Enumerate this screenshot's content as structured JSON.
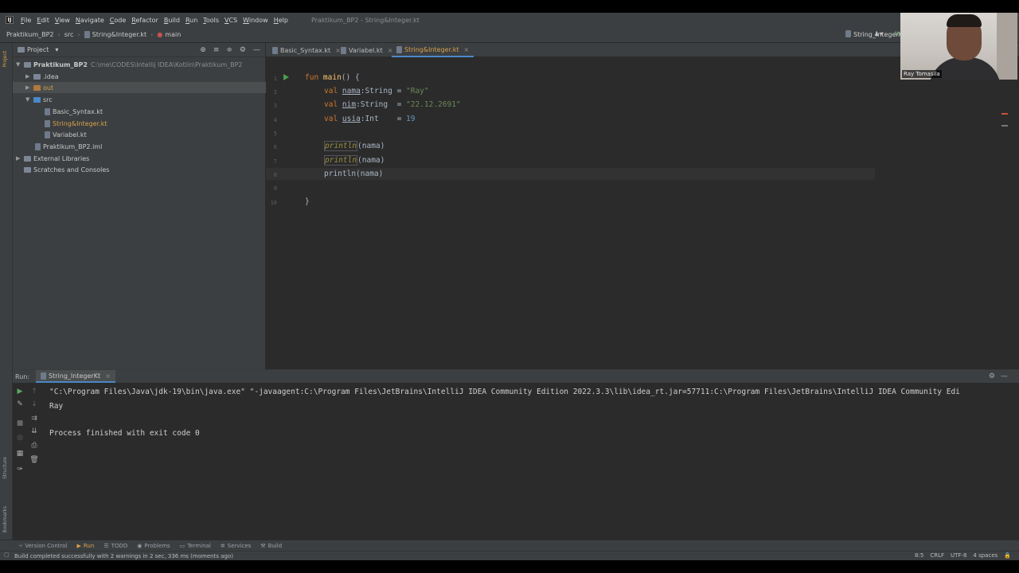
{
  "menubar": {
    "logo": "IJ",
    "items": [
      "File",
      "Edit",
      "View",
      "Navigate",
      "Code",
      "Refactor",
      "Build",
      "Run",
      "Tools",
      "VCS",
      "Window",
      "Help"
    ],
    "window_title": "Praktikum_BP2 - String&Integer.kt"
  },
  "navbar": {
    "project": "Praktikum_BP2",
    "src": "src",
    "file": "String&Integer.kt",
    "function": "main",
    "run_config": "String_IntegerKt"
  },
  "project_panel": {
    "title": "Project",
    "tree": [
      {
        "label": "Praktikum_BP2",
        "path": "C:\\me\\CODES\\Intellij IDEA\\Kotlin\\Praktikum_BP2"
      },
      {
        "label": ".idea"
      },
      {
        "label": "out"
      },
      {
        "label": "src"
      },
      {
        "label": "Basic_Syntax.kt"
      },
      {
        "label": "String&Integer.kt"
      },
      {
        "label": "Variabel.kt"
      },
      {
        "label": "Praktikum_BP2.iml"
      },
      {
        "label": "External Libraries"
      },
      {
        "label": "Scratches and Consoles"
      }
    ]
  },
  "editor_tabs": [
    "Basic_Syntax.kt",
    "Variabel.kt",
    "String&Integer.kt"
  ],
  "editor": {
    "line_numbers": [
      "1",
      "2",
      "3",
      "4",
      "5",
      "6",
      "7",
      "8",
      "9",
      "10"
    ],
    "l1_fun": "fun",
    "l1_name": "main",
    "l1_rest": "() {",
    "val": "val",
    "l2_var": "nama",
    "l2_type": ":String",
    "l2_eq": " = ",
    "l2_val": "\"Ray\"",
    "l3_var": "nim",
    "l3_type": ":String",
    "l3_eq": "  = ",
    "l3_val": "\"22.12.2691\"",
    "l4_var": "usia",
    "l4_type": ":Int",
    "l4_eq": "    = ",
    "l4_val": "19",
    "println": "println",
    "println_arg": "(nama)",
    "close_brace": "}"
  },
  "run_panel": {
    "label": "Run:",
    "tab": "String_IntegerKt",
    "console": [
      "\"C:\\Program Files\\Java\\jdk-19\\bin\\java.exe\" \"-javaagent:C:\\Program Files\\JetBrains\\IntelliJ IDEA Community Edition 2022.3.3\\lib\\idea_rt.jar=57711:C:\\Program Files\\JetBrains\\IntelliJ IDEA Community Edi",
      "Ray",
      "",
      "Process finished with exit code 0"
    ]
  },
  "bottom_tabs": [
    "Version Control",
    "Run",
    "TODO",
    "Problems",
    "Terminal",
    "Services",
    "Build"
  ],
  "side_tabs": {
    "project": "Project",
    "structure": "Structure",
    "bookmarks": "Bookmarks"
  },
  "status": {
    "message": "Build completed successfully with 2 warnings in 2 sec, 336 ms (moments ago)",
    "position": "8:5",
    "line_sep": "CRLF",
    "encoding": "UTF-8",
    "indent": "4 spaces"
  },
  "webcam": {
    "name": "Ray Tomasila"
  },
  "colors": {
    "keyword": "#cc7832",
    "function": "#ffc66d",
    "string": "#6a8759",
    "number": "#6897bb",
    "accent": "#4a88c7"
  }
}
